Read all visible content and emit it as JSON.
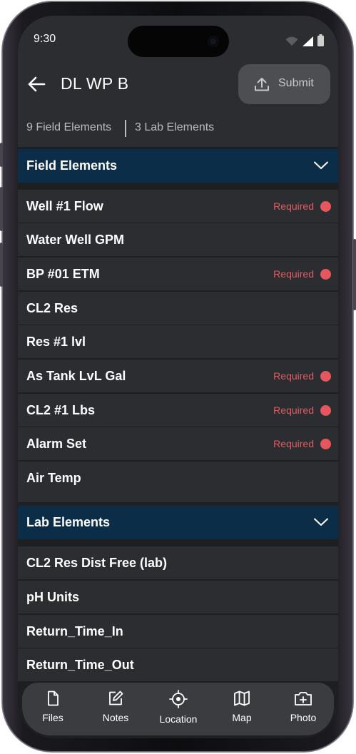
{
  "status_bar": {
    "time": "9:30"
  },
  "app_bar": {
    "title": "DL WP B",
    "submit_label": "Submit"
  },
  "counts": {
    "field": "9 Field Elements",
    "lab": "3 Lab Elements"
  },
  "field_section": {
    "title": "Field Elements",
    "items": [
      {
        "label": "Well #1 Flow",
        "required": "Required"
      },
      {
        "label": "Water Well GPM",
        "required": ""
      },
      {
        "label": "BP #01 ETM",
        "required": "Required"
      },
      {
        "label": "CL2 Res",
        "required": ""
      },
      {
        "label": "Res #1 lvl",
        "required": ""
      },
      {
        "label": "As Tank LvL Gal",
        "required": "Required"
      },
      {
        "label": "CL2 #1 Lbs",
        "required": "Required"
      },
      {
        "label": "Alarm Set",
        "required": "Required"
      },
      {
        "label": "Air Temp",
        "required": ""
      }
    ]
  },
  "lab_section": {
    "title": "Lab Elements",
    "items": [
      {
        "label": "CL2 Res Dist Free (lab)"
      },
      {
        "label": "pH Units"
      },
      {
        "label": "Return_Time_In"
      },
      {
        "label": "Return_Time_Out"
      }
    ]
  },
  "bottom_nav": {
    "items": [
      {
        "label": "Files",
        "icon": "file-icon"
      },
      {
        "label": "Notes",
        "icon": "edit-note-icon"
      },
      {
        "label": "Location",
        "icon": "location-target-icon"
      },
      {
        "label": "Map",
        "icon": "map-icon"
      },
      {
        "label": "Photo",
        "icon": "add-photo-icon"
      }
    ]
  },
  "colors": {
    "header_blue": "#0c2d48",
    "required_red": "#e05d63",
    "surface": "#2b2d30",
    "background": "#1e1f21"
  }
}
